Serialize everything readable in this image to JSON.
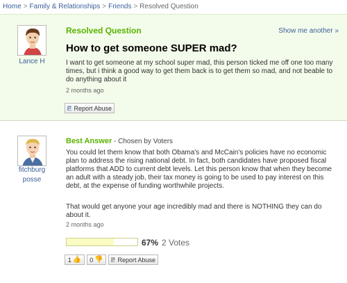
{
  "breadcrumb": {
    "home": "Home",
    "family": "Family & Relationships",
    "friends": "Friends",
    "current": "Resolved Question",
    "separator": ">"
  },
  "question": {
    "section_title": "Resolved Question",
    "show_more": "Show me another »",
    "asker": "Lance H",
    "title": "How to get someone SUPER mad?",
    "body": "I want to get someone at my school super mad, this person ticked me off one too many times, but i think a good way to get them back is to get them so mad, and not beable to do anything about it",
    "time": "2 months ago",
    "report_abuse": "Report Abuse"
  },
  "answer": {
    "label": "Best Answer",
    "chosen_by": " - Chosen by Voters",
    "answerer_line1": "fitchburg",
    "answerer_line2": "posse",
    "para1": "You could let them know that both Obama's and McCain's policies have no economic plan to address the rising national debt. In fact, both candidates have proposed fiscal platforms that ADD to current debt levels. Let this person know that when they become an adult with a steady job, their tax money is going to be used to pay interest on this debt, at the expense of funding worthwhile projects.",
    "para2": "That would get anyone your age incredibly mad and there is NOTHING they can do about it.",
    "time": "2 months ago",
    "vote_percent": "67%",
    "vote_fraction": 0.67,
    "vote_count": "2 Votes",
    "thumbs_up": "1",
    "thumbs_down": "0",
    "report_abuse": "Report Abuse"
  },
  "colors": {
    "accent_green": "#59b300",
    "link_blue": "#3a5f9a",
    "question_bg": "#f3fbea",
    "vote_fill": "#fafcc4"
  },
  "icons": [
    "flag-icon",
    "thumbs-up-icon",
    "thumbs-down-icon"
  ]
}
